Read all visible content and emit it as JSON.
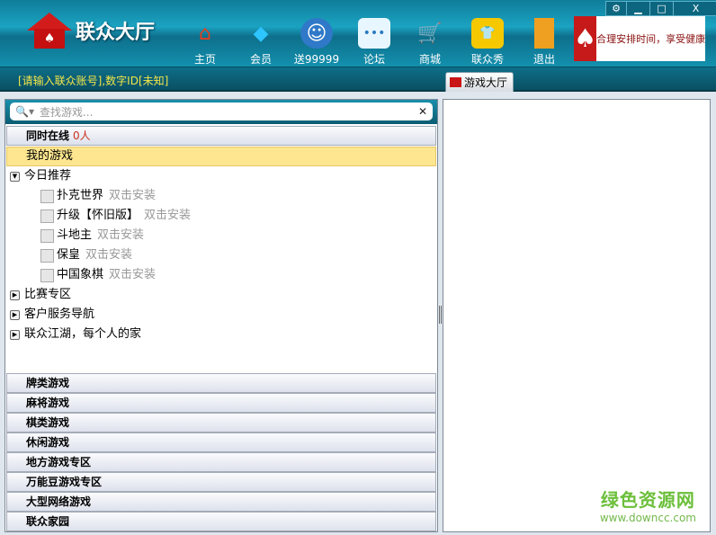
{
  "app": {
    "logo_text": "联众大厅"
  },
  "nav": [
    {
      "label": "主页",
      "icon": "home-icon"
    },
    {
      "label": "会员",
      "icon": "diamond-icon"
    },
    {
      "label": "送99999",
      "icon": "shark-icon"
    },
    {
      "label": "论坛",
      "icon": "chat-bubble-icon"
    },
    {
      "label": "商城",
      "icon": "cart-icon"
    },
    {
      "label": "联众秀",
      "icon": "tshirt-icon"
    },
    {
      "label": "退出",
      "icon": "door-icon"
    }
  ],
  "ad": {
    "text": "合理安排时间，享受健康生活"
  },
  "window_controls": {
    "settings": "⚙",
    "minimize": "▁",
    "maximize": "□",
    "close": "X"
  },
  "status": {
    "account": "[请输入联众账号],数字ID[未知]"
  },
  "tab": {
    "label": "游戏大厅"
  },
  "search": {
    "placeholder": "查找游戏..."
  },
  "online": {
    "label": "同时在线",
    "count": "0人"
  },
  "my_games": "我的游戏",
  "today": {
    "label": "今日推荐",
    "items": [
      {
        "name": "扑克世界",
        "hint": "双击安装"
      },
      {
        "name": "升级【怀旧版】",
        "hint": "双击安装"
      },
      {
        "name": "斗地主",
        "hint": "双击安装"
      },
      {
        "name": "保皇",
        "hint": "双击安装"
      },
      {
        "name": "中国象棋",
        "hint": "双击安装"
      }
    ]
  },
  "tree_nodes": [
    "比赛专区",
    "客户服务导航",
    "联众江湖，每个人的家"
  ],
  "categories": [
    "牌类游戏",
    "麻将游戏",
    "棋类游戏",
    "休闲游戏",
    "地方游戏专区",
    "万能豆游戏专区",
    "大型网络游戏",
    "联众家园"
  ],
  "watermark": {
    "title": "绿色资源网",
    "url": "www.downcc.com"
  }
}
